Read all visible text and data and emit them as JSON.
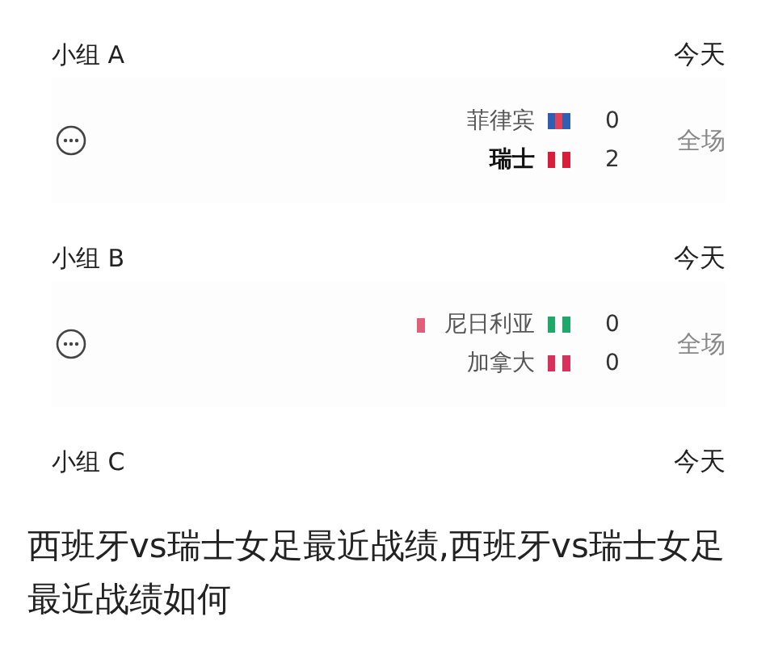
{
  "groups": [
    {
      "name": "小组 A",
      "day": "今天",
      "match": {
        "status": "全场",
        "teams": [
          {
            "name": "菲律宾",
            "score": "0",
            "red_card": false
          },
          {
            "name": "瑞士",
            "score": "2",
            "red_card": false
          }
        ]
      }
    },
    {
      "name": "小组 B",
      "day": "今天",
      "match": {
        "status": "全场",
        "teams": [
          {
            "name": "尼日利亚",
            "score": "0",
            "red_card": true
          },
          {
            "name": "加拿大",
            "score": "0",
            "red_card": false
          }
        ]
      }
    },
    {
      "name": "小组 C",
      "day": "今天"
    }
  ],
  "caption": "西班牙vs瑞士女足最近战绩,西班牙vs瑞士女足最近战绩如何"
}
